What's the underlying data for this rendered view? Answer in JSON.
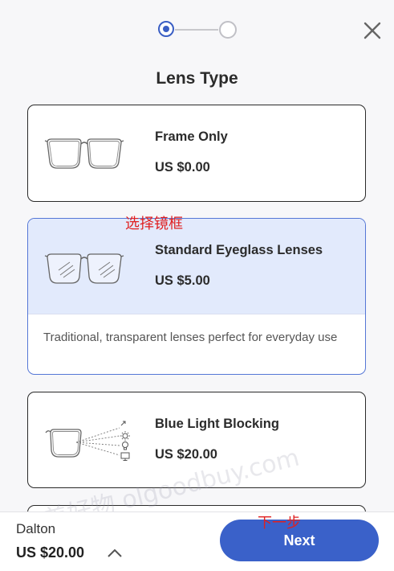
{
  "page": {
    "title": "Lens Type"
  },
  "stepper": {
    "current_step": 1,
    "total_steps": 2
  },
  "options": [
    {
      "name": "Frame Only",
      "price": "US $0.00",
      "selected": false,
      "icon": "frame-glasses-icon"
    },
    {
      "name": "Standard Eyeglass Lenses",
      "price": "US $5.00",
      "selected": true,
      "icon": "clear-lens-glasses-icon",
      "description": "Traditional, transparent lenses perfect for everyday use"
    },
    {
      "name": "Blue Light Blocking",
      "price": "US $20.00",
      "selected": false,
      "icon": "blue-light-glasses-icon"
    }
  ],
  "annotations": {
    "select_frame": "选择镜框",
    "next_step": "下一步"
  },
  "watermark": "美好物 olgoodbuy.com",
  "footer": {
    "product_name": "Dalton",
    "total": "US $20.00",
    "next_label": "Next"
  },
  "colors": {
    "accent": "#3a61c9",
    "selected_bg": "#e2eafc",
    "annotation": "#e02020"
  }
}
